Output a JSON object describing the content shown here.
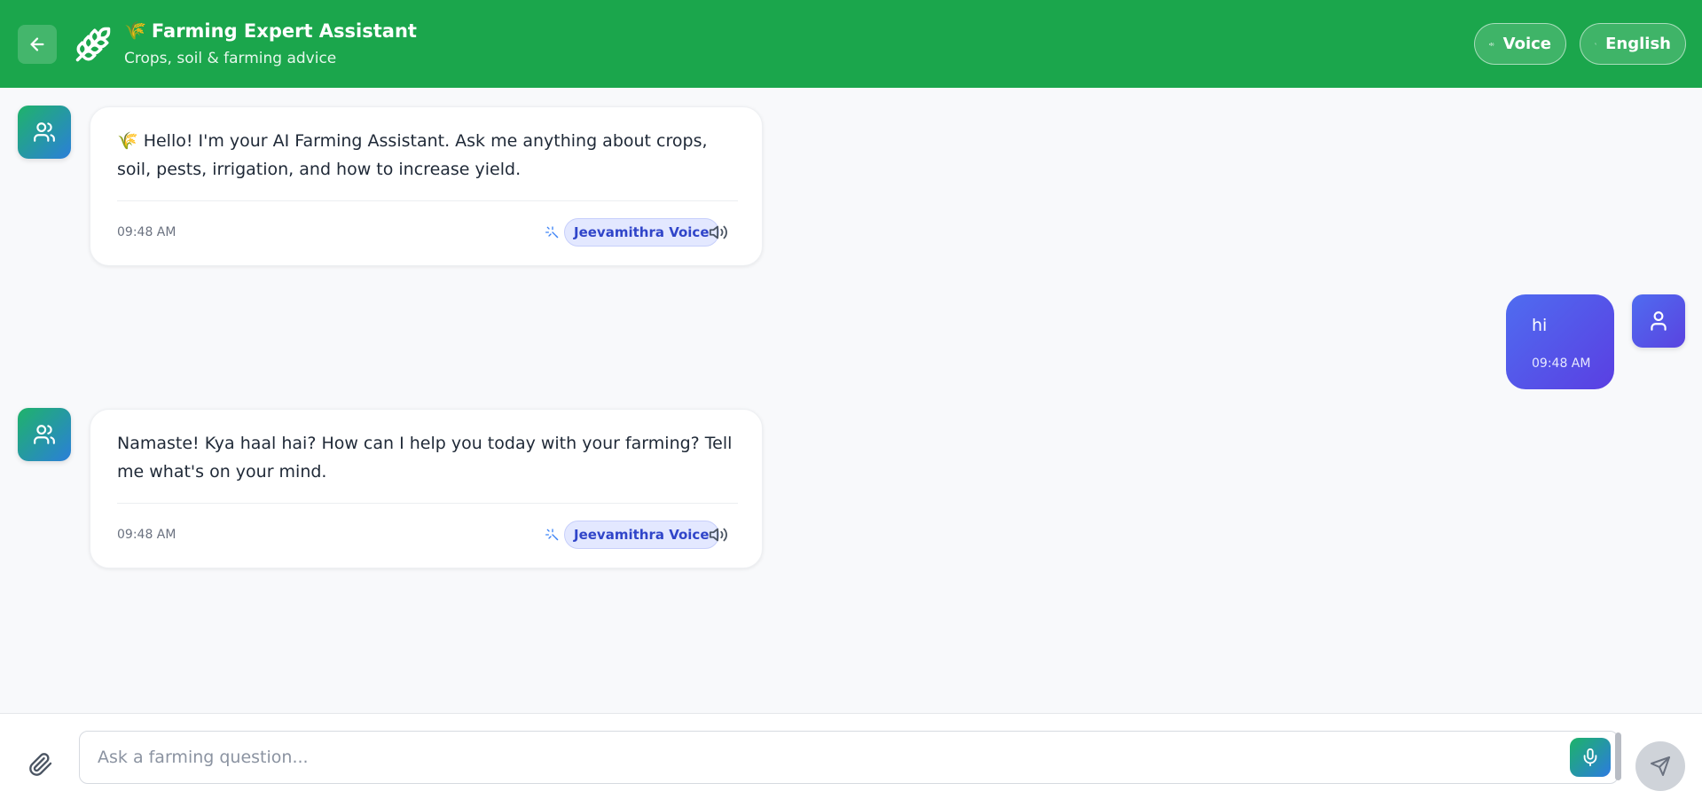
{
  "header": {
    "title_emoji": "🌾",
    "title": "Farming Expert Assistant",
    "subtitle": "Crops, soil & farming advice",
    "voice_label": "Voice",
    "language_label": "English",
    "brand_color": "#1ba64c"
  },
  "messages": [
    {
      "sender": "bot",
      "text": "🌾 Hello! I'm your AI Farming Assistant. Ask me anything about crops, soil, pests, irrigation, and how to increase yield.",
      "time": "09:48 AM",
      "badge": "Jeevamithra Voice"
    },
    {
      "sender": "user",
      "text": "hi",
      "time": "09:48 AM"
    },
    {
      "sender": "bot",
      "text": "Namaste!  Kya haal hai?  How can I help you today with your farming?  Tell me what's on your mind.",
      "time": "09:48 AM",
      "badge": "Jeevamithra Voice"
    }
  ],
  "composer": {
    "placeholder": "Ask a farming question...",
    "value": ""
  },
  "icons": {
    "back": "arrow-left-icon",
    "logo": "wheat-icon",
    "voice": "speaker-icon",
    "language": "translate-icon",
    "bot_avatar": "users-icon",
    "user_avatar": "user-icon",
    "attach": "paperclip-icon",
    "mic": "mic-icon",
    "send": "send-icon"
  }
}
